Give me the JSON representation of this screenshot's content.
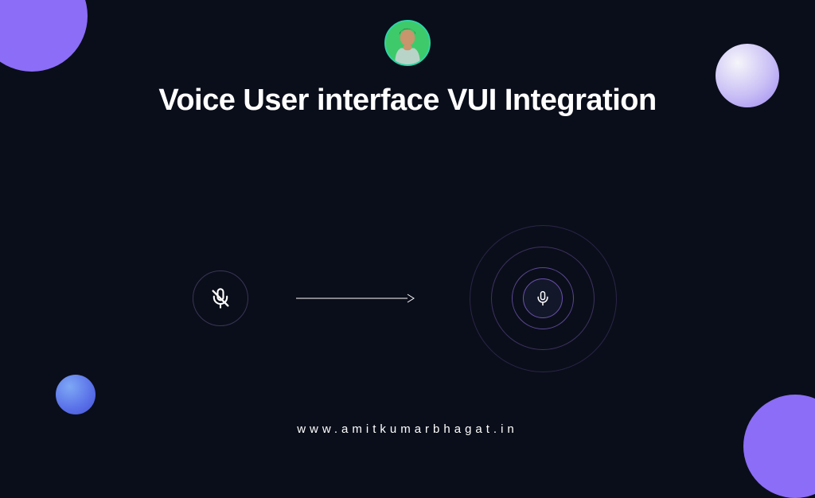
{
  "title": "Voice User interface VUI Integration",
  "footer_url": "www.amitkumarbhagat.in",
  "colors": {
    "background": "#0a0e1a",
    "accent_purple": "#8b6df7",
    "accent_blue": "#5970e8",
    "avatar_border": "#2dd4a7",
    "text": "#ffffff"
  },
  "diagram": {
    "state_from": "microphone-muted",
    "state_to": "microphone-active",
    "transition": "arrow-right"
  }
}
